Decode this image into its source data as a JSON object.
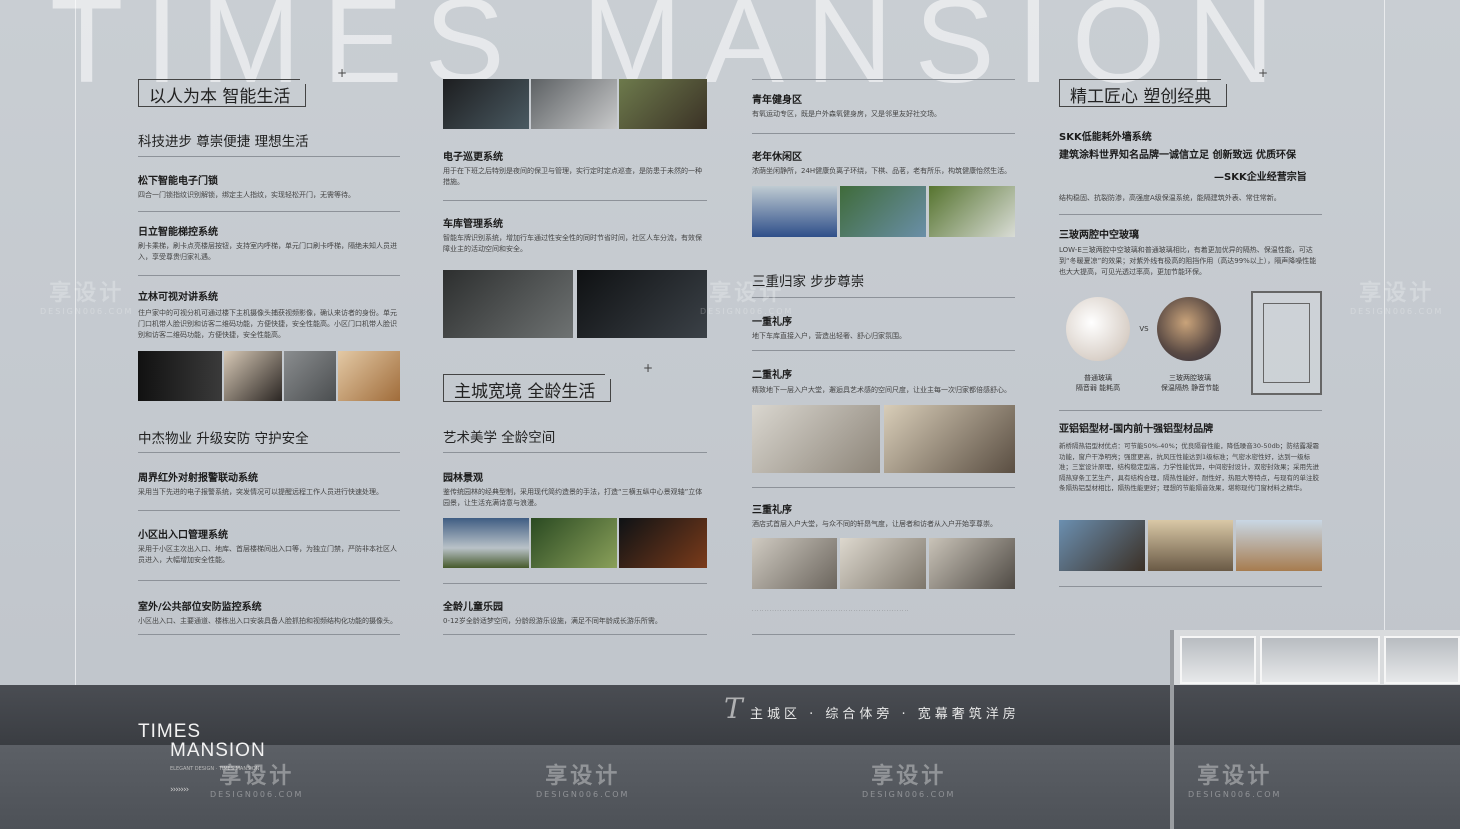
{
  "background_word": "TIMES MANSION",
  "columns": {
    "col1": {
      "title": "以人为本 智能生活",
      "subtitle": "科技进步 尊崇便捷 理想生活",
      "sections": [
        {
          "title": "松下智能电子门锁",
          "text": "四合一门锁指纹识别解锁，绑定主人指纹，实现轻松开门，无需等待。"
        },
        {
          "title": "日立智能梯控系统",
          "text": "刷卡乘梯，刷卡点亮楼层按钮，支持室内呼梯，单元门口刷卡呼梯，隔绝未知人员进入，享受尊贵归家礼遇。"
        },
        {
          "title": "立林可视对讲系统",
          "text": "住户家中的可视分机可通过楼下主机摄像头捕获视频影像，确认来访者的身份。单元门口机带人脸识别和访客二维码功能，方便快捷，安全性能高。小区门口机带人脸识别和访客二维码功能，方便快捷，安全性能高。"
        }
      ],
      "subtitle2": "中杰物业 升级安防 守护安全",
      "sections2": [
        {
          "title": "周界红外对射报警联动系统",
          "text": "采用当下先进的电子报警系统，突发情况可以提醒远程工作人员进行快速处理。"
        },
        {
          "title": "小区出入口管理系统",
          "text": "采用于小区主次出入口、地库、首层楼梯间出入口等，为独立门禁，严防非本社区人员进入，大幅增加安全性能。"
        },
        {
          "title": "室外/公共部位安防监控系统",
          "text": "小区出入口、主要通道、楼栋出入口安装具备人脸抓拍和视频结构化功能的摄像头。"
        }
      ]
    },
    "col2": {
      "sections": [
        {
          "title": "电子巡更系统",
          "text": "用于在下班之后特别是夜间的保卫与管理，实行定时定点巡查，是防患于未然的一种措施。"
        },
        {
          "title": "车库管理系统",
          "text": "智能车牌识别系统，增加行车通过性安全性的同时节省时间，社区人车分流，有效保障业主的活动空间和安全。"
        }
      ],
      "title": "主城宽境 全龄生活",
      "subtitle": "艺术美学 全龄空间",
      "sections2": [
        {
          "title": "园林景观",
          "text": "鉴传统园林的经典型制，采用现代简约造景的手法，打造“三横五纵中心景观轴”立体园景，让生活充满诗意与浪漫。"
        },
        {
          "title": "全龄儿童乐园",
          "text": "0-12岁全龄适梦空间，分龄段游乐设施，满足不同年龄成长游乐所需。"
        }
      ]
    },
    "col3": {
      "sections": [
        {
          "title": "青年健身区",
          "text": "有氧运动专区，既是户外森氧健身房，又是邻里友好社交场。"
        },
        {
          "title": "老年休闲区",
          "text": "浓荫坐闲静所，24H健康负离子环绕，下棋、品茗，老有所乐，构筑健康怡然生活。"
        }
      ],
      "subtitle": "三重归家 步步尊崇",
      "sections2": [
        {
          "title": "一重礼序",
          "text": "地下车库直接入户，营造出轻奢、舒心归家氛围。"
        },
        {
          "title": "二重礼序",
          "text": "精致地下一层入户大堂，邂逅具艺术感的空间尺度，让业主每一次归家都倍感舒心。"
        },
        {
          "title": "三重礼序",
          "text": "酒店式首层入户大堂，与众不同的轩昂气度，让居者和访者从入户开始享尊崇。"
        }
      ]
    },
    "col4": {
      "title": "精工匠心 塑创经典",
      "skk": {
        "title": "SKK低能耗外墙系统",
        "line2": "建筑涂料世界知名品牌一诚信立足 创新致远 优质环保",
        "line3": "—SKK企业经营宗旨",
        "text": "结构稳固、抗裂防渗，高强度A级保温系统，能隔建筑外表、常住常新。"
      },
      "glass": {
        "title": "三玻两腔中空玻璃",
        "text": "LOW-E三玻两腔中空玻璃和普通玻璃相比，有着更加优异的隔热、保温性能，可达到“冬暖夏凉”的效果；对紫外线有极高的阻挡作用（高达99%以上），隔声降噪性能也大大提高，可见光透过率高，更加节能环保。",
        "vs": "VS",
        "caption1_a": "普通玻璃",
        "caption1_b": "隔音弱 能耗高",
        "caption2_a": "三玻两腔玻璃",
        "caption2_b": "保温隔热 静音节能"
      },
      "alu": {
        "title": "亚铝铝型材-国内前十强铝型材品牌",
        "text": "新桥隔热铝型材优点：可节能50%-40%；优良隔音性能，降低噪音30-50db；防结露凝霜功能，窗户干净明亮；强度更高，抗风压性能达到1级标准；气密水密性好，达到一级标准；三室设计原理，结构稳定型高，力学性能优异，中间密封设计，双密封效果；采用先进隔热穿条工艺生产，具有结构合理，隔热性能好，耐性好，热阻大等特点，与现有的单注胶条隔热铝型材相比，隔热性能更好；理想的节能隔音效果，堪称现代门窗材料之精华。"
      }
    }
  },
  "footer": {
    "slogan": "主城区 · 综合体旁 · 宽幕奢筑洋房",
    "slogan_mark": "T",
    "logo_line1": "TIMES",
    "logo_line2": "MANSION",
    "logo_small": "ELEGANT DESIGN · TIMES MANSION",
    "arrows": "›››››››"
  },
  "watermark": {
    "text": "享设计",
    "sub": "DESIGN006.COM"
  },
  "colors": {
    "background": "#c6cbd1",
    "footer": "#3f4247",
    "text": "#222222",
    "accent_line": "#8d9299"
  }
}
